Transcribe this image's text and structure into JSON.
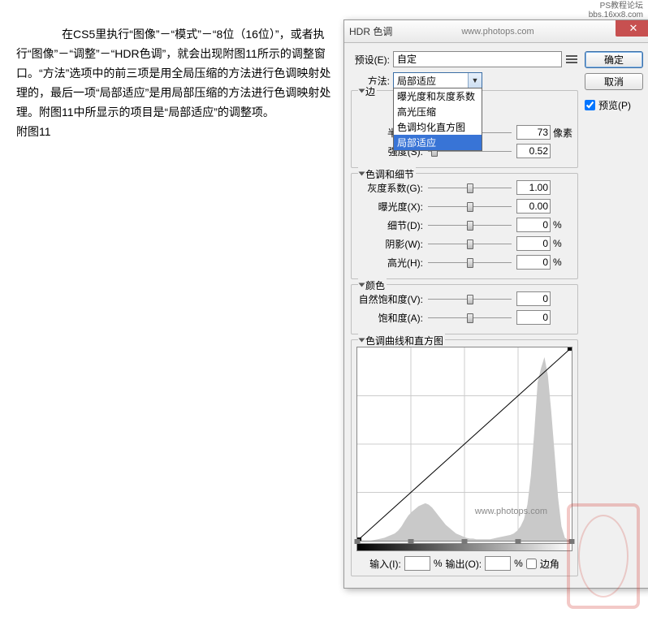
{
  "watermark_top": {
    "line1": "PS教程论坛",
    "line2": "bbs.16xx8.com"
  },
  "article": {
    "para": "　　在CS5里执行“图像”－“模式”－“8位（16位）”，或者执行“图像”－“调整”－“HDR色调”，就会出现附图11所示的调整窗口。“方法”选项中的前三项是用全局压缩的方法进行色调映射处理的，最后一项“局部适应”是用局部压缩的方法进行色调映射处理。附图11中所显示的项目是“局部适应”的调整项。",
    "caption": "附图11"
  },
  "dialog": {
    "title": "HDR 色调",
    "titlebar_url": "www.photops.com",
    "close": "✕",
    "preset_label": "预设(E):",
    "preset_value": "自定",
    "ok": "确定",
    "cancel": "取消",
    "preview_label": "预览(P)",
    "method_label": "方法:",
    "method_value": "局部适应",
    "method_options": [
      "曝光度和灰度系数",
      "高光压缩",
      "色调均化直方图",
      "局部适应"
    ],
    "group_edge": "边",
    "radius_label": "半径(R):",
    "radius_value": "73",
    "radius_unit": "像素",
    "strength_label": "强度(S):",
    "strength_value": "0.52",
    "group_tone": "色调和细节",
    "gamma_label": "灰度系数(G):",
    "gamma_value": "1.00",
    "exposure_label": "曝光度(X):",
    "exposure_value": "0.00",
    "detail_label": "细节(D):",
    "detail_value": "0",
    "shadow_label": "阴影(W):",
    "shadow_value": "0",
    "highlight_label": "高光(H):",
    "highlight_value": "0",
    "pct": "%",
    "group_color": "颜色",
    "vibrance_label": "自然饱和度(V):",
    "vibrance_value": "0",
    "saturation_label": "饱和度(A):",
    "saturation_value": "0",
    "group_curve": "色调曲线和直方图",
    "curve_url": "www.photops.com",
    "input_label": "输入(I):",
    "output_label": "输出(O):",
    "corner_label": "边角"
  },
  "chart_data": {
    "type": "line",
    "title": "色调曲线和直方图",
    "xlabel": "输入",
    "ylabel": "输出",
    "xlim": [
      0,
      255
    ],
    "ylim": [
      0,
      255
    ],
    "curve": [
      [
        0,
        0
      ],
      [
        255,
        255
      ]
    ],
    "histogram_buckets": [
      0,
      0,
      0,
      0,
      0,
      1,
      2,
      3,
      4,
      6,
      8,
      10,
      14,
      20,
      28,
      35,
      40,
      44,
      48,
      50,
      52,
      50,
      46,
      40,
      34,
      28,
      22,
      18,
      14,
      10,
      8,
      6,
      4,
      3,
      3,
      2,
      2,
      2,
      2,
      2,
      3,
      4,
      5,
      6,
      7,
      8,
      10,
      14,
      20,
      30,
      50,
      90,
      150,
      220,
      240,
      255,
      230,
      180,
      120,
      60,
      20,
      4,
      1,
      0
    ]
  }
}
